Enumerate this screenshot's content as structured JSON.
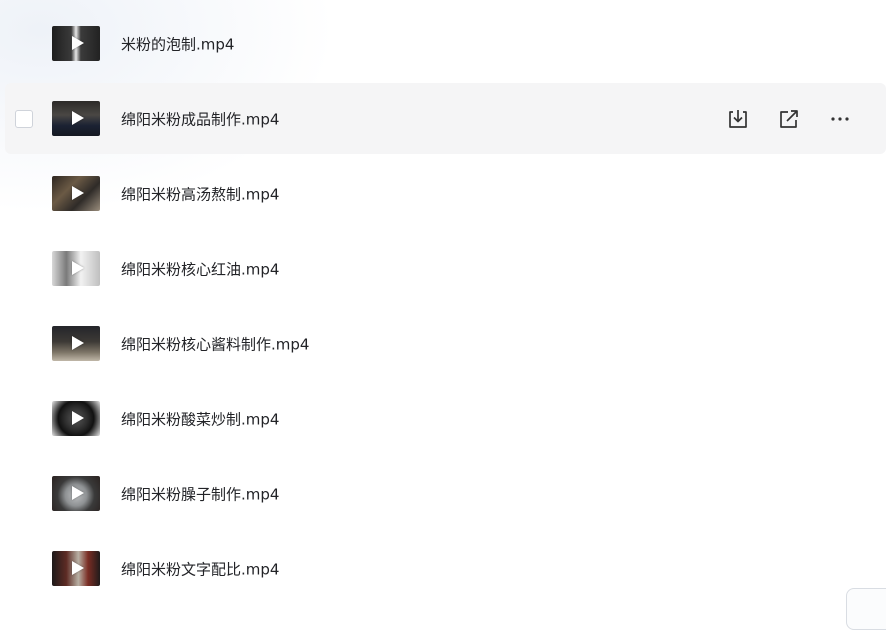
{
  "files": [
    {
      "name": "米粉的泡制.mp4",
      "thumb_icon": "video-thumbnail-icon",
      "active": false
    },
    {
      "name": "绵阳米粉成品制作.mp4",
      "thumb_icon": "video-thumbnail-icon",
      "active": true
    },
    {
      "name": "绵阳米粉高汤熬制.mp4",
      "thumb_icon": "video-thumbnail-icon",
      "active": false
    },
    {
      "name": "绵阳米粉核心红油.mp4",
      "thumb_icon": "video-thumbnail-icon",
      "active": false
    },
    {
      "name": "绵阳米粉核心酱料制作.mp4",
      "thumb_icon": "video-thumbnail-icon",
      "active": false
    },
    {
      "name": "绵阳米粉酸菜炒制.mp4",
      "thumb_icon": "video-thumbnail-icon",
      "active": false
    },
    {
      "name": "绵阳米粉臊子制作.mp4",
      "thumb_icon": "video-thumbnail-icon",
      "active": false
    },
    {
      "name": "绵阳米粉文字配比.mp4",
      "thumb_icon": "video-thumbnail-icon",
      "active": false
    }
  ],
  "row_actions": {
    "download_icon": "download-icon",
    "share_icon": "share-icon",
    "more_icon": "more-icon"
  },
  "colors": {
    "text": "#222327",
    "hover_row": "#f5f5f6",
    "icon": "#333333"
  }
}
